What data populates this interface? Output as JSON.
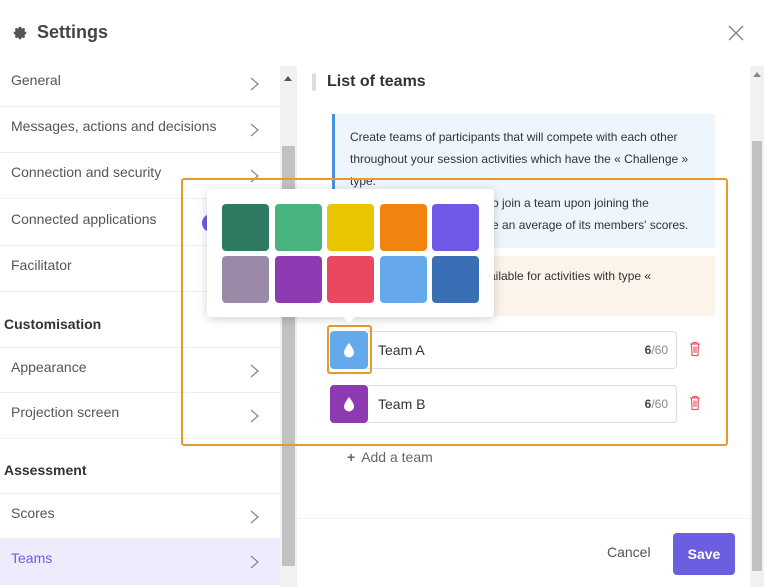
{
  "header": {
    "title": "Settings"
  },
  "sidebar": {
    "items_top": [
      {
        "label": "General"
      },
      {
        "label": "Messages, actions and decisions"
      },
      {
        "label": "Connection and security"
      },
      {
        "label": "Connected applications"
      },
      {
        "label": "Facilitator"
      }
    ],
    "section_customisation": "Customisation",
    "items_custom": [
      {
        "label": "Appearance"
      },
      {
        "label": "Projection screen"
      }
    ],
    "section_assessment": "Assessment",
    "items_assessment": [
      {
        "label": "Scores"
      },
      {
        "label": "Teams"
      }
    ]
  },
  "main": {
    "section_title": "List of teams",
    "info1_line1": "Create teams of participants that will compete with each other",
    "info1_line2": "throughout your session activities which have the « Challenge »",
    "info1_line3": "type.",
    "info1_line4": "o join a team upon joining the",
    "info1_line5": "e an average of its members' scores.",
    "info2_line1": "ailable for activities with type «",
    "teams": [
      {
        "name": "Team A",
        "count": "6",
        "max": "/60",
        "color": "#66a8ec"
      },
      {
        "name": "Team B",
        "count": "6",
        "max": "/60",
        "color": "#8e3bb3"
      }
    ],
    "add_team": "Add a team"
  },
  "palette": [
    "#2f7a62",
    "#48b37c",
    "#e9c400",
    "#f0840e",
    "#6f5ae8",
    "#9a8aa8",
    "#8e3bb3",
    "#ea4861",
    "#66a8ec",
    "#3a6fb5"
  ],
  "footer": {
    "cancel": "Cancel",
    "save": "Save"
  },
  "colors": {
    "accent": "#6b5ee0",
    "highlight": "#e59b2a"
  }
}
